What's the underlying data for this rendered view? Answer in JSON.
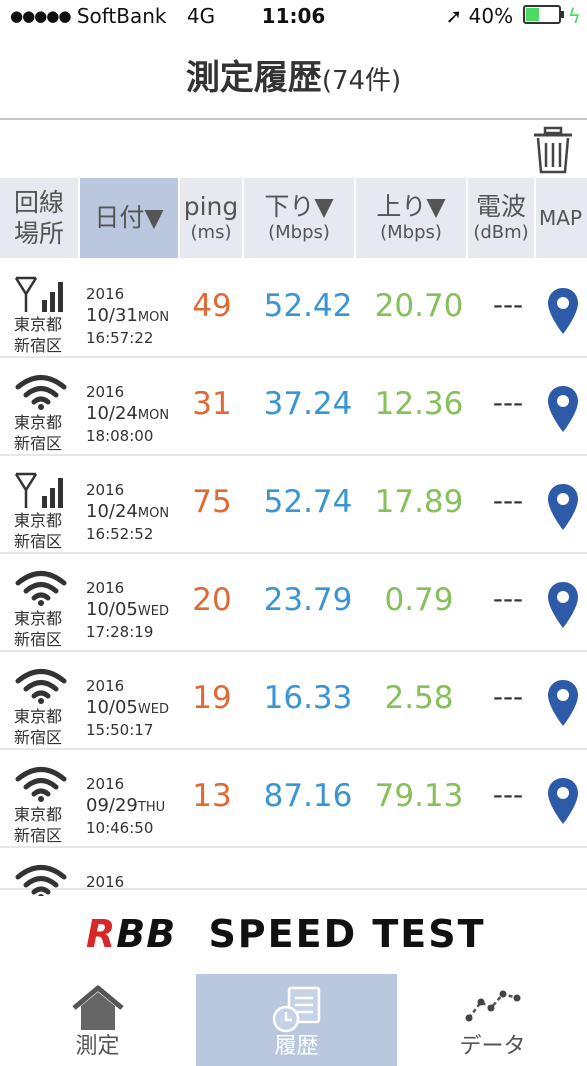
{
  "status_bar": {
    "signal_dots": "●●●●●",
    "carrier": "SoftBank",
    "network": "4G",
    "time": "11:06",
    "location_arrow": "➚",
    "battery_text": "40%",
    "charging": "ϟ"
  },
  "title": {
    "main": "測定履歴",
    "count": "(74件)"
  },
  "header": {
    "location": "回線\n場所",
    "date": "日付▼",
    "ping": "ping",
    "ping_unit": "(ms)",
    "down": "下り▼",
    "down_unit": "(Mbps)",
    "up": "上り▼",
    "up_unit": "(Mbps)",
    "signal": "電波",
    "signal_unit": "(dBm)",
    "map": "MAP"
  },
  "rows": [
    {
      "type": "cell",
      "pref": "東京都",
      "ward": "新宿区",
      "year": "2016",
      "md": "10/31",
      "dow": "MON",
      "time": "16:57:22",
      "ping": "49",
      "down": "52.42",
      "up": "20.70",
      "signal": "---"
    },
    {
      "type": "wifi",
      "pref": "東京都",
      "ward": "新宿区",
      "year": "2016",
      "md": "10/24",
      "dow": "MON",
      "time": "18:08:00",
      "ping": "31",
      "down": "37.24",
      "up": "12.36",
      "signal": "---"
    },
    {
      "type": "cell",
      "pref": "東京都",
      "ward": "新宿区",
      "year": "2016",
      "md": "10/24",
      "dow": "MON",
      "time": "16:52:52",
      "ping": "75",
      "down": "52.74",
      "up": "17.89",
      "signal": "---"
    },
    {
      "type": "wifi",
      "pref": "東京都",
      "ward": "新宿区",
      "year": "2016",
      "md": "10/05",
      "dow": "WED",
      "time": "17:28:19",
      "ping": "20",
      "down": "23.79",
      "up": "0.79",
      "signal": "---"
    },
    {
      "type": "wifi",
      "pref": "東京都",
      "ward": "新宿区",
      "year": "2016",
      "md": "10/05",
      "dow": "WED",
      "time": "15:50:17",
      "ping": "19",
      "down": "16.33",
      "up": "2.58",
      "signal": "---"
    },
    {
      "type": "wifi",
      "pref": "東京都",
      "ward": "新宿区",
      "year": "2016",
      "md": "09/29",
      "dow": "THU",
      "time": "10:46:50",
      "ping": "13",
      "down": "87.16",
      "up": "79.13",
      "signal": "---"
    },
    {
      "type": "wifi",
      "pref": "",
      "ward": "",
      "year": "2016",
      "md": "",
      "dow": "",
      "time": "",
      "ping": "",
      "down": "",
      "up": "",
      "signal": ""
    }
  ],
  "brand": {
    "logo": "RBB",
    "name": "SPEED TEST"
  },
  "tabs": [
    {
      "label": "測定",
      "icon": "home-icon"
    },
    {
      "label": "履歴",
      "icon": "history-icon"
    },
    {
      "label": "データ",
      "icon": "graph-icon"
    }
  ],
  "colors": {
    "ping": "#e06a35",
    "down": "#3a95d4",
    "up": "#86c05a",
    "pin": "#2d5ba8",
    "selected": "#b9c8de"
  }
}
